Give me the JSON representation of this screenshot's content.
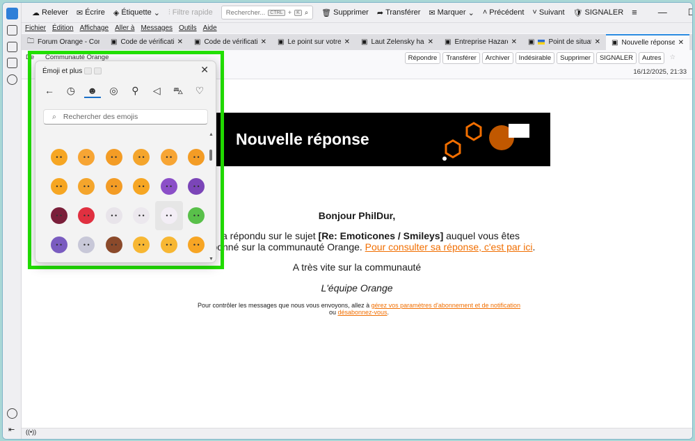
{
  "toolbar": {
    "items": [
      {
        "icon": "cloud-icon",
        "label": "Relever"
      },
      {
        "icon": "compose-icon",
        "label": "Écrire"
      },
      {
        "icon": "tag-icon",
        "label": "Étiquette"
      },
      {
        "icon": "filter-icon",
        "label": "Filtre rapide"
      }
    ],
    "search_placeholder": "Rechercher...",
    "shortcut_ctrl": "CTRL",
    "shortcut_plus": "+",
    "shortcut_k": "K",
    "right": [
      {
        "icon": "trash-icon",
        "label": "Supprimer"
      },
      {
        "icon": "forward-icon",
        "label": "Transférer"
      },
      {
        "icon": "mark-icon",
        "label": "Marquer"
      },
      {
        "icon": "chevron-up-icon",
        "label": "Précédent"
      },
      {
        "icon": "chevron-down-icon",
        "label": "Suivant"
      },
      {
        "icon": "report-icon",
        "label": "SIGNALER"
      }
    ]
  },
  "menu": [
    "Fichier",
    "Édition",
    "Affichage",
    "Aller à",
    "Messages",
    "Outils",
    "Aide"
  ],
  "tabs": [
    "Forum Orange - Comp",
    "Code de vérification",
    "Code de vérification",
    "Le point sur votre r",
    "Laut Zelensky habe",
    "Entreprise Hazard p",
    "Point de situation",
    "Nouvelle réponse s"
  ],
  "header": {
    "from_label": "De",
    "from": "Communauté Orange",
    "date": "16/12/2025, 21:33",
    "buttons": [
      "Répondre",
      "Transférer",
      "Archiver",
      "Indésirable",
      "Supprimer",
      "SIGNALER",
      "Autres"
    ]
  },
  "email": {
    "banner_title": "Nouvelle réponse",
    "greeting": "Bonjour PhilDur,",
    "line1_pre": "a répondu sur le sujet ",
    "line1_bold": "[Re: Emoticones / Smileys]",
    "line1_post": " auquel vous êtes",
    "line2_pre": "abonné sur la communauté Orange. ",
    "line2_link": "Pour consulter sa réponse, c'est par ici",
    "line2_post": ".",
    "closing": "A très vite sur la communauté",
    "signature": "L'équipe Orange",
    "footer_pre": "Pour contrôler les messages que nous vous envoyons, allez à ",
    "footer_link1": "gérez vos paramètres d'abonnement et de notification",
    "footer_mid": " ou ",
    "footer_link2": "désabonnez-vous",
    "footer_post": "."
  },
  "emoji_panel": {
    "title": "Émoji et plus",
    "search_placeholder": "Rechercher des emojis",
    "categories": [
      "back-arrow-icon",
      "recent-clock-icon",
      "smiley-icon",
      "people-icon",
      "balloon-icon",
      "pizza-icon",
      "car-icon",
      "heart-icon"
    ],
    "emojis": [
      [
        "lying-face",
        "#f6a623"
      ],
      [
        "flushed-face",
        "#f7a534"
      ],
      [
        "relieved-sweat-face",
        "#f39c25"
      ],
      [
        "sleeping-face",
        "#f4a52c"
      ],
      [
        "shushing-face",
        "#f7a534"
      ],
      [
        "hand-over-mouth-face",
        "#f39c25"
      ],
      [
        "peeking-face",
        "#f6a623"
      ],
      [
        "yawning-face",
        "#f4a52c"
      ],
      [
        "monocle-face",
        "#f39c25"
      ],
      [
        "nerd-face",
        "#f6a623"
      ],
      [
        "smiling-devil",
        "#8b4fc8"
      ],
      [
        "angry-devil",
        "#7b45b8"
      ],
      [
        "ogre",
        "#7a1f3a"
      ],
      [
        "goblin",
        "#e03040"
      ],
      [
        "skull",
        "#e8e4ea"
      ],
      [
        "skull-crossbones",
        "#ece8ee"
      ],
      [
        "ghost",
        "#f3eef6"
      ],
      [
        "alien",
        "#59c04a"
      ],
      [
        "alien-monster",
        "#7a5cc0"
      ],
      [
        "robot",
        "#c8c8d8"
      ],
      [
        "poop",
        "#8b4a2b"
      ],
      [
        "cat-face",
        "#f7b733"
      ],
      [
        "grinning-cat",
        "#f7b733"
      ],
      [
        "cat-tears-of-joy",
        "#f7a524"
      ]
    ]
  },
  "status": "((•))"
}
